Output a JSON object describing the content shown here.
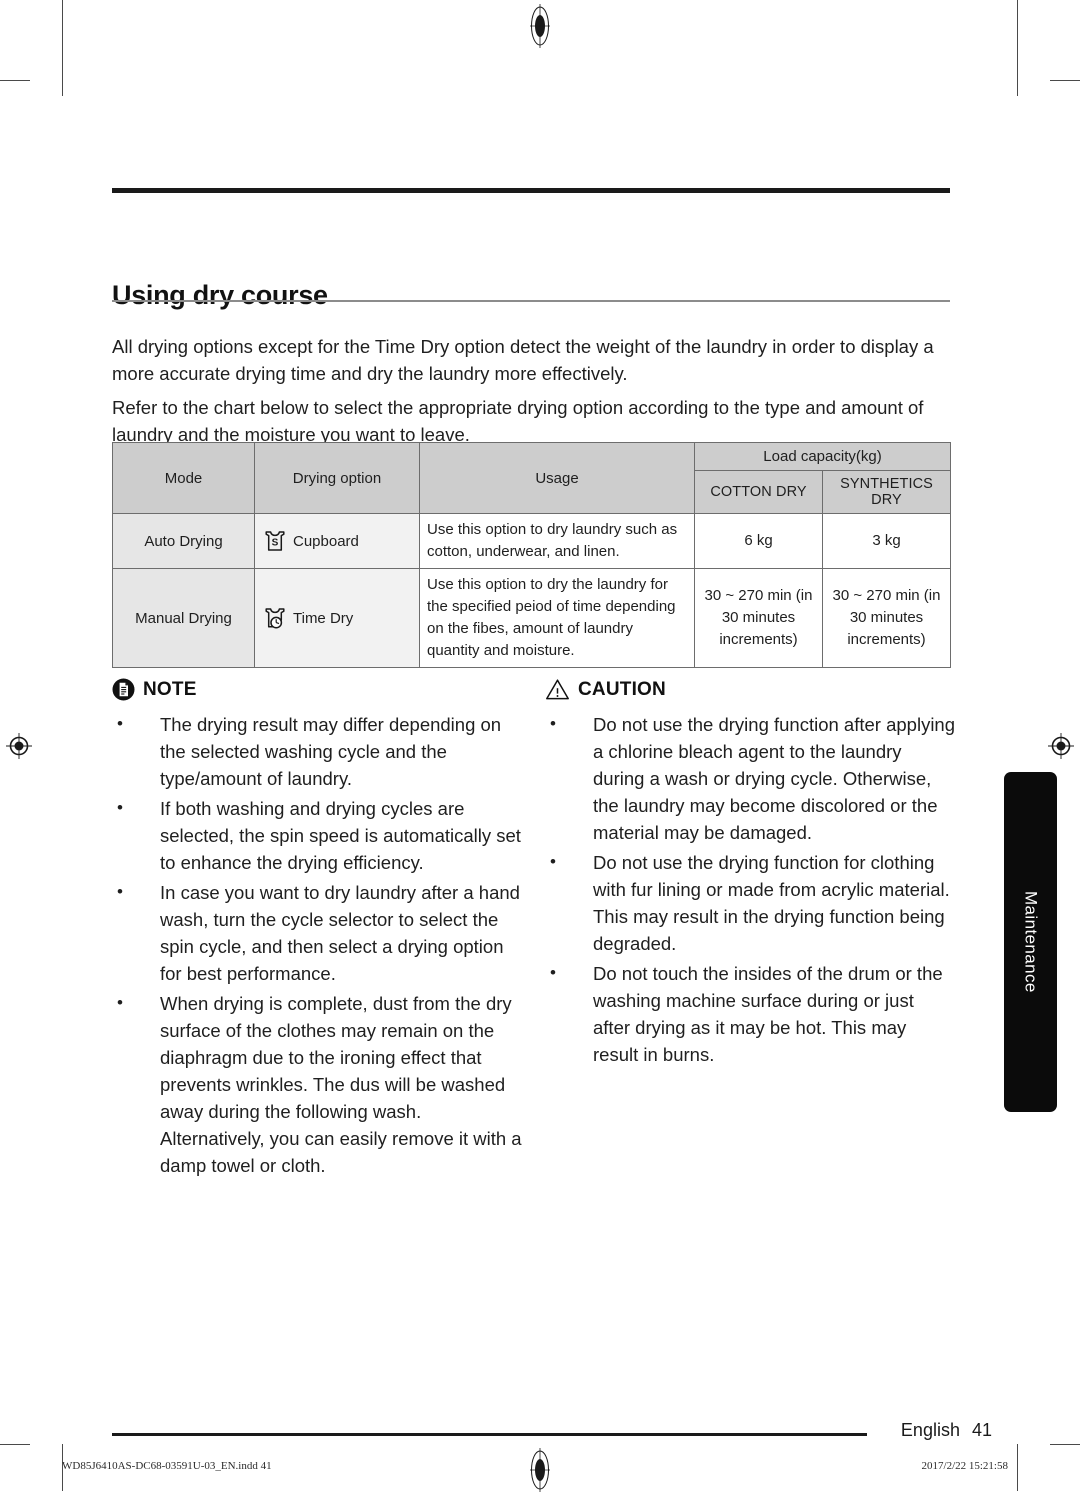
{
  "document": {
    "title": "Using dry course",
    "intro_paragraphs": [
      "All drying options except for the Time Dry option detect the weight of the laundry in order to display a more accurate drying time and dry the laundry more effectively.",
      "Refer to the chart below to select the appropriate drying option according to the type and amount of laundry and the moisture you want to leave."
    ]
  },
  "table": {
    "headers": {
      "mode": "Mode",
      "drying_option": "Drying option",
      "usage": "Usage",
      "load_capacity": "Load capacity(kg)",
      "cotton_dry": "COTTON DRY",
      "synthetics_dry": "SYNTHETICS DRY"
    },
    "rows": [
      {
        "mode": "Auto Drying",
        "option_icon": "tshirt-s-icon",
        "option": "Cupboard",
        "usage": "Use this option to dry laundry such as cotton, underwear, and linen.",
        "cotton_dry": "6 kg",
        "synthetics_dry": "3 kg"
      },
      {
        "mode": "Manual Drying",
        "option_icon": "tshirt-clock-icon",
        "option": "Time Dry",
        "usage": "Use this option to dry the laundry for the specified peiod of time depending on the fibes, amount of laundry quantity and moisture.",
        "cotton_dry": "30 ~ 270 min (in 30 minutes increments)",
        "synthetics_dry": "30 ~ 270 min (in 30 minutes increments)"
      }
    ]
  },
  "note": {
    "icon": "note-document-icon",
    "title": "NOTE",
    "items": [
      "The drying result may differ depending on the selected washing cycle and the type/amount of laundry.",
      "If both washing and drying cycles are selected, the spin speed is automatically set to enhance the drying efficiency.",
      "In case you want to dry laundry after a hand wash, turn the cycle selector to select the spin cycle, and then select a drying option for best performance.",
      "When drying is complete, dust from the dry surface of the clothes may remain on the diaphragm due to the ironing effect that prevents wrinkles. The dus will be washed away during the following wash. Alternatively, you can easily remove it with a damp towel or cloth."
    ]
  },
  "caution": {
    "icon": "warning-triangle-icon",
    "title": "CAUTION",
    "items": [
      "Do not use the drying function after applying a chlorine bleach agent to the laundry during a wash or drying cycle. Otherwise, the laundry may become discolored or the material may be damaged.",
      "Do not use the drying function for clothing with fur lining or made from acrylic material. This may result in the drying function being degraded.",
      "Do not touch the insides of the drum or the washing machine surface during or just after drying as it may be hot. This may result in burns."
    ]
  },
  "side_tab": {
    "label": "Maintenance"
  },
  "footer": {
    "language": "English",
    "page_number": "41",
    "imprint_file": "WD85J6410AS-DC68-03591U-03_EN.indd   41",
    "imprint_timestamp": "2017/2/22   15:21:58"
  },
  "colors": {
    "header_fill": "#cdcdcd",
    "mode_fill": "#e6e6e6",
    "option_fill": "#f2f2f2",
    "tab_fill": "#0b0b0b",
    "rule": "#1a1a1a"
  }
}
